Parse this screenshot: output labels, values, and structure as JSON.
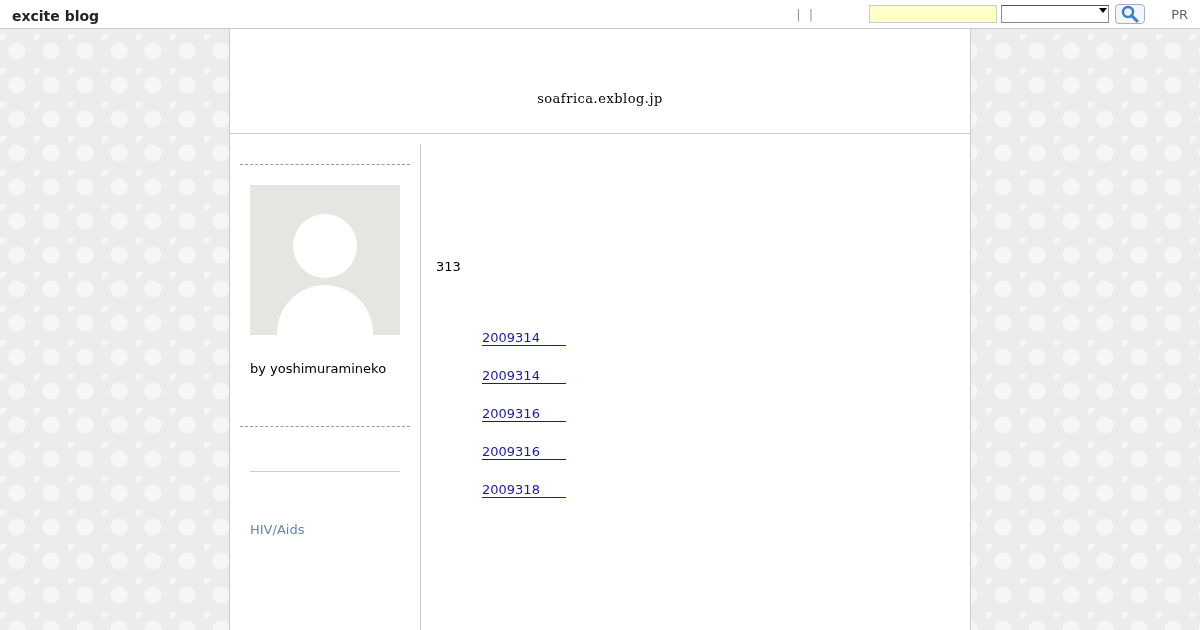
{
  "header": {
    "logo": "excite blog",
    "separators": [
      "|",
      "|"
    ],
    "pr": "PR"
  },
  "blog": {
    "title": "soafrica.exblog.jp"
  },
  "sidebar": {
    "author": "by yoshimuramineko",
    "category": "HIV/Aids"
  },
  "main": {
    "count": "313",
    "links": [
      {
        "label": "2009314"
      },
      {
        "label": "2009314"
      },
      {
        "label": "2009316"
      },
      {
        "label": "2009316"
      },
      {
        "label": "2009318"
      }
    ]
  }
}
